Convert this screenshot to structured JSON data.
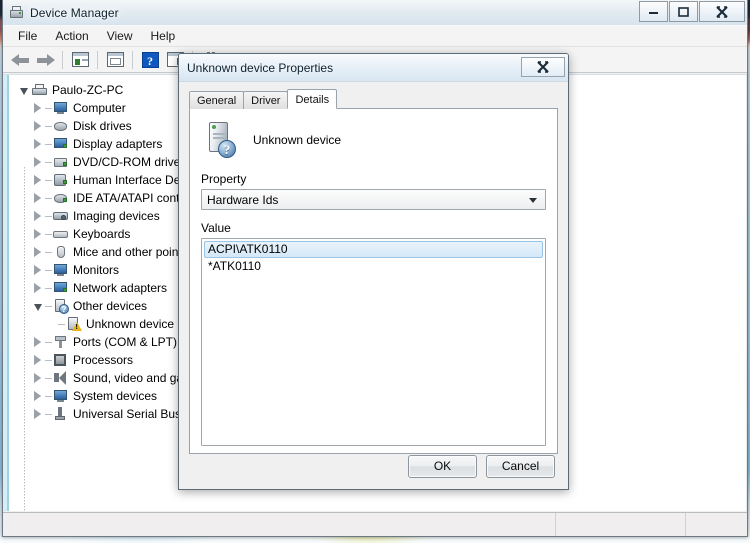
{
  "window": {
    "title": "Device Manager",
    "icon": "device-manager-icon",
    "caption_buttons": [
      {
        "name": "minimize-button",
        "glyph": "—"
      },
      {
        "name": "maximize-button",
        "glyph": "□"
      },
      {
        "name": "close-button",
        "glyph": "✕"
      }
    ]
  },
  "menubar": {
    "items": [
      {
        "label": "File",
        "name": "menu-file"
      },
      {
        "label": "Action",
        "name": "menu-action"
      },
      {
        "label": "View",
        "name": "menu-view"
      },
      {
        "label": "Help",
        "name": "menu-help"
      }
    ]
  },
  "toolbar": {
    "buttons": [
      {
        "name": "back-button",
        "icon": "arrow-left-icon"
      },
      {
        "name": "forward-button",
        "icon": "arrow-right-icon"
      },
      {
        "name": "show-hide-console-tree-button",
        "icon": "console-tree-icon"
      },
      {
        "name": "properties-button",
        "icon": "properties-icon"
      },
      {
        "name": "help-button",
        "icon": "help-icon"
      },
      {
        "name": "update-driver-button",
        "icon": "update-driver-icon"
      },
      {
        "name": "scan-hardware-changes-button",
        "icon": "scan-hardware-icon"
      }
    ]
  },
  "tree": {
    "root": {
      "label": "Paulo-ZC-PC",
      "icon": "computer-root-icon",
      "expanded": true
    },
    "items": [
      {
        "label": "Computer",
        "icon": "computer-icon",
        "expanded": false
      },
      {
        "label": "Disk drives",
        "icon": "disk-drive-icon",
        "expanded": false
      },
      {
        "label": "Display adapters",
        "icon": "display-adapter-icon",
        "expanded": false
      },
      {
        "label": "DVD/CD-ROM drives",
        "icon": "dvd-drive-icon",
        "expanded": false
      },
      {
        "label": "Human Interface Devic",
        "icon": "hid-icon",
        "expanded": false
      },
      {
        "label": "IDE ATA/ATAPI contro",
        "icon": "ide-controller-icon",
        "expanded": false
      },
      {
        "label": "Imaging devices",
        "icon": "imaging-device-icon",
        "expanded": false
      },
      {
        "label": "Keyboards",
        "icon": "keyboard-icon",
        "expanded": false
      },
      {
        "label": "Mice and other pointin",
        "icon": "mouse-icon",
        "expanded": false
      },
      {
        "label": "Monitors",
        "icon": "monitor-icon",
        "expanded": false
      },
      {
        "label": "Network adapters",
        "icon": "network-adapter-icon",
        "expanded": false
      },
      {
        "label": "Other devices",
        "icon": "other-devices-icon",
        "expanded": true
      },
      {
        "label": "Unknown device",
        "icon": "unknown-device-warning-icon",
        "child": true
      },
      {
        "label": "Ports (COM & LPT)",
        "icon": "ports-icon",
        "expanded": false
      },
      {
        "label": "Processors",
        "icon": "processor-icon",
        "expanded": false
      },
      {
        "label": "Sound, video and gam",
        "icon": "sound-device-icon",
        "expanded": false
      },
      {
        "label": "System devices",
        "icon": "system-device-icon",
        "expanded": false
      },
      {
        "label": "Universal Serial Bus co",
        "icon": "usb-controller-icon",
        "expanded": false
      }
    ]
  },
  "statusbar": {
    "segments": [
      "",
      "",
      ""
    ]
  },
  "dialog": {
    "title": "Unknown device Properties",
    "close_glyph": "✕",
    "tabs": [
      {
        "label": "General",
        "name": "tab-general",
        "active": false
      },
      {
        "label": "Driver",
        "name": "tab-driver",
        "active": false
      },
      {
        "label": "Details",
        "name": "tab-details",
        "active": true
      }
    ],
    "device_name": "Unknown device",
    "device_icon": "unknown-device-icon",
    "question_glyph": "?",
    "property_label": "Property",
    "property_selected": "Hardware Ids",
    "value_label": "Value",
    "values": [
      {
        "text": "ACPI\\ATK0110",
        "selected": true
      },
      {
        "text": "*ATK0110",
        "selected": false
      }
    ],
    "buttons": [
      {
        "label": "OK",
        "name": "ok-button"
      },
      {
        "label": "Cancel",
        "name": "cancel-button"
      }
    ]
  }
}
